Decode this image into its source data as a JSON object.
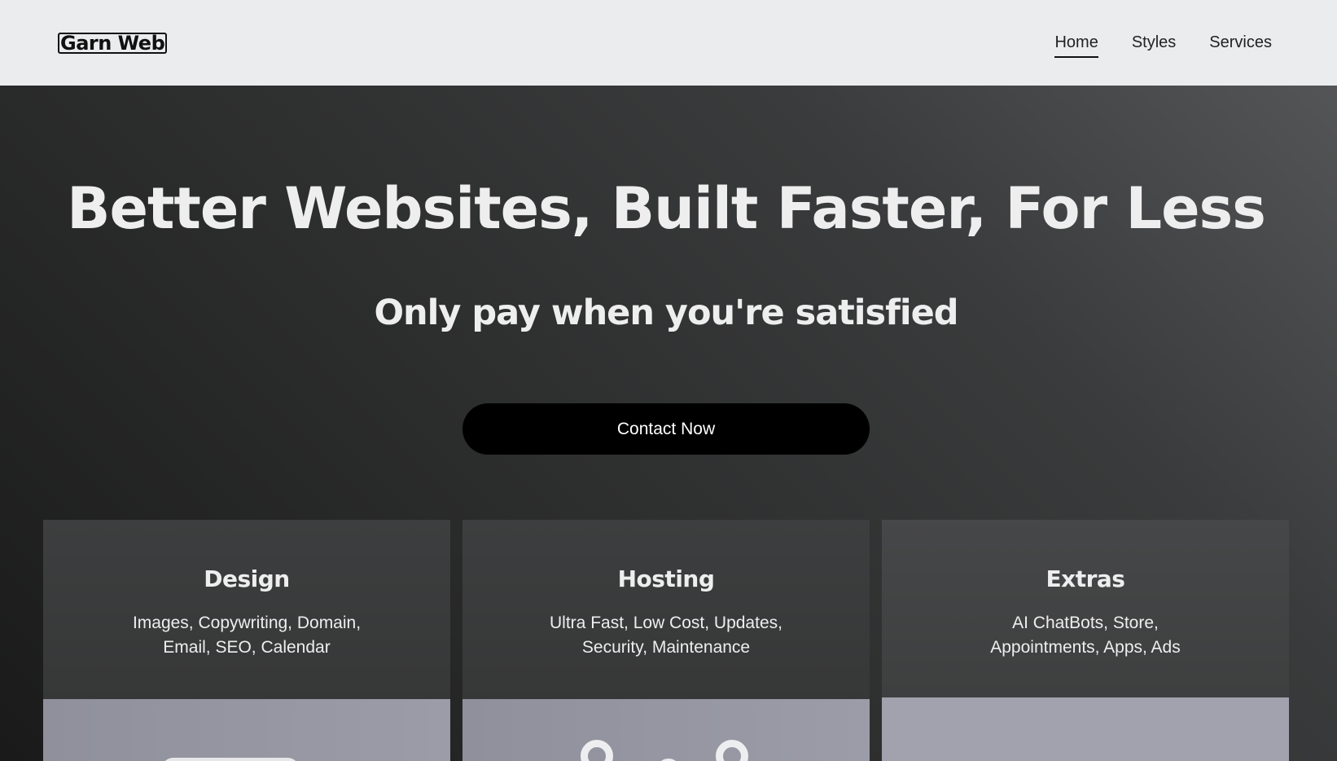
{
  "header": {
    "logo": "Garn Web",
    "nav": [
      {
        "label": "Home",
        "active": true
      },
      {
        "label": "Styles",
        "active": false
      },
      {
        "label": "Services",
        "active": false
      }
    ]
  },
  "hero": {
    "title": "Better Websites, Built Faster, For Less",
    "subtitle": "Only pay when you're satisfied",
    "cta_label": "Contact Now"
  },
  "cards": [
    {
      "title": "Design",
      "text_line1": "Images, Copywriting, Domain,",
      "text_line2": "Email, SEO, Calendar"
    },
    {
      "title": "Hosting",
      "text_line1": "Ultra Fast, Low Cost, Updates,",
      "text_line2": "Security, Maintenance"
    },
    {
      "title": "Extras",
      "text_line1": "AI ChatBots, Store,",
      "text_line2": "Appointments, Apps, Ads"
    }
  ],
  "colors": {
    "header_bg": "#ebecee",
    "cta_bg": "#000000",
    "hero_text": "#eeeeef"
  }
}
